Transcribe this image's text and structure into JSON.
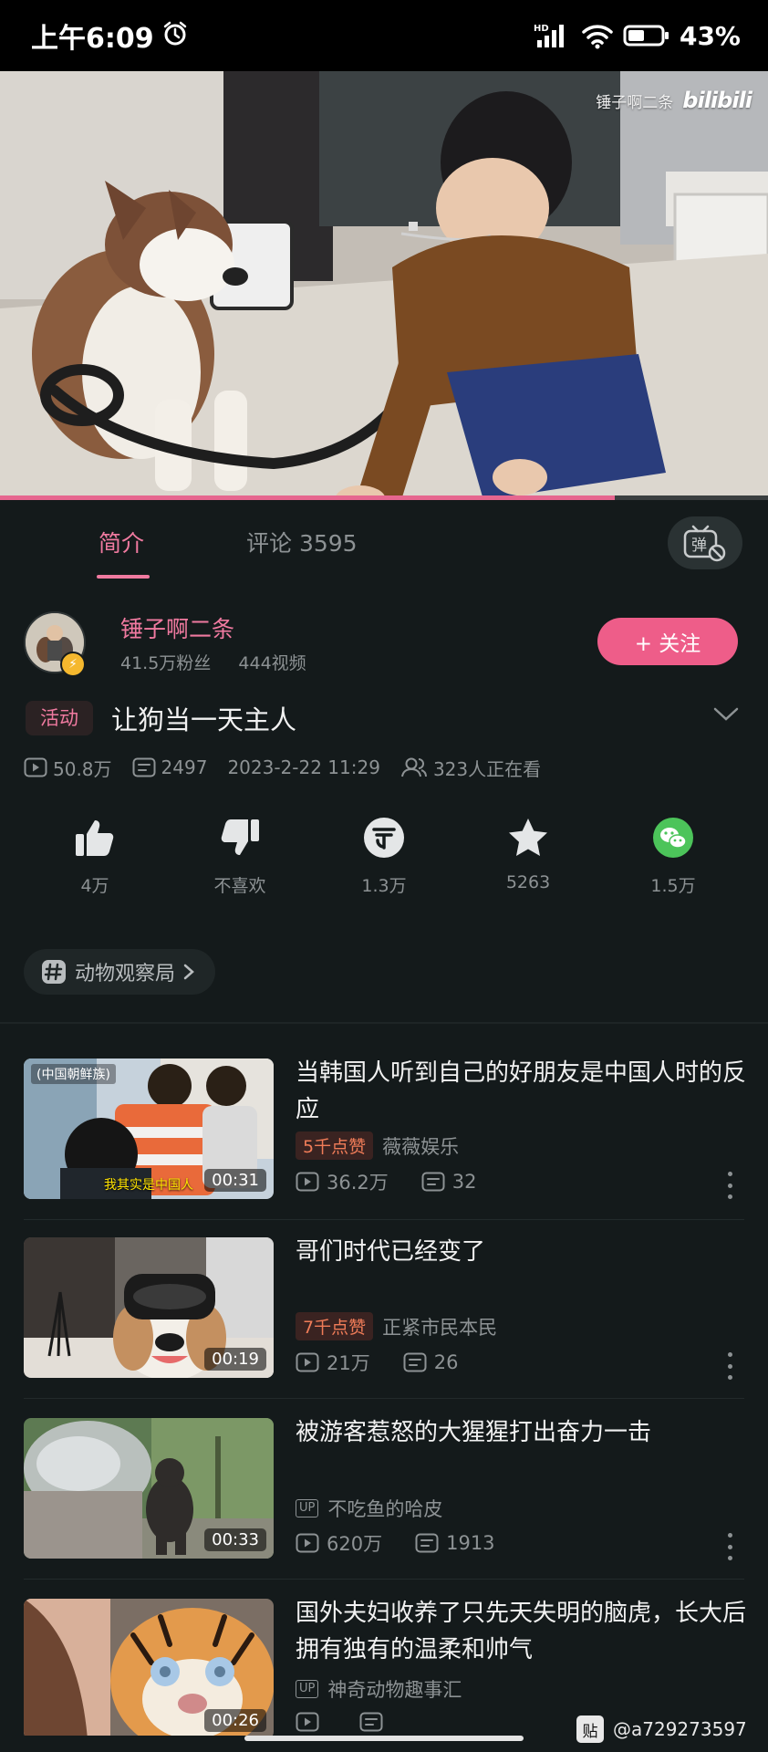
{
  "status_bar": {
    "time": "上午6:09",
    "battery": "43%",
    "network": "HD"
  },
  "video": {
    "watermark_author": "锤子啊二条",
    "watermark_logo": "bilibili",
    "progress": 0.8
  },
  "tabs": [
    {
      "label": "简介",
      "active": true
    },
    {
      "label": "评论 3595",
      "active": false
    }
  ],
  "danmaku_toggle": {
    "glyph": "弹"
  },
  "uploader": {
    "name": "锤子啊二条",
    "fans": "41.5万粉丝",
    "videos": "444视频",
    "follow_label": "+ 关注"
  },
  "title": {
    "tag": "活动",
    "text": "让狗当一天主人"
  },
  "meta": {
    "views": "50.8万",
    "danmaku": "2497",
    "date": "2023-2-22 11:29",
    "watching": "323人正在看"
  },
  "actions": [
    {
      "name": "like",
      "label": "4万"
    },
    {
      "name": "dislike",
      "label": "不喜欢"
    },
    {
      "name": "coin",
      "label": "1.3万"
    },
    {
      "name": "favorite",
      "label": "5263"
    },
    {
      "name": "share",
      "label": "1.5万"
    }
  ],
  "topic": {
    "label": "动物观察局"
  },
  "recommendations": [
    {
      "title": "当韩国人听到自己的好朋友是中国人时的反应",
      "badge": "5千点赞",
      "up": "",
      "author": "薇薇娱乐",
      "views": "36.2万",
      "danmaku": "32",
      "duration": "00:31",
      "thumb_caption": "(中国朝鲜族)",
      "thumb_subtitle": "我其实是中国人"
    },
    {
      "title": "哥们时代已经变了",
      "badge": "7千点赞",
      "up": "",
      "author": "正紧市民本民",
      "views": "21万",
      "danmaku": "26",
      "duration": "00:19"
    },
    {
      "title": "被游客惹怒的大猩猩打出奋力一击",
      "badge": "",
      "up": "UP",
      "author": "不吃鱼的哈皮",
      "views": "620万",
      "danmaku": "1913",
      "duration": "00:33"
    },
    {
      "title": "国外夫妇收养了只先天失明的脑虎，长大后拥有独有的温柔和帅气",
      "badge": "",
      "up": "UP",
      "author": "神奇动物趣事汇",
      "views": "",
      "danmaku": "",
      "duration": "00:26"
    }
  ],
  "corner_watermark": {
    "glyph": "贴",
    "handle": "@a729273597"
  },
  "colors": {
    "accent": "#ee5d89",
    "background": "#141a1b",
    "muted": "#8d9294",
    "wechat": "#4cc45a"
  }
}
